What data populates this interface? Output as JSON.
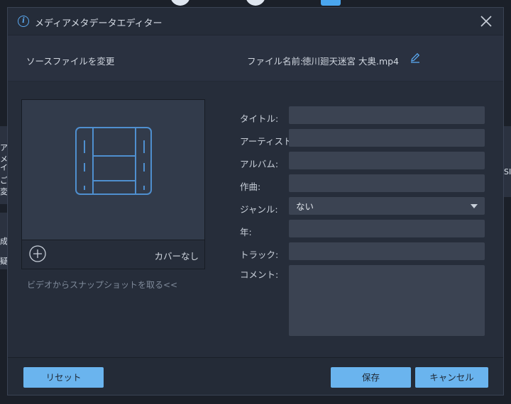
{
  "dialog": {
    "title": "メディアメタデータエディター",
    "source_change": "ソースファイルを変更",
    "filename_label": "ファイル名前:",
    "filename_value": "徳川廻天迷宮 大奥.mp4"
  },
  "cover": {
    "none_label": "カバーなし",
    "snapshot_link": "ビデオからスナップショットを取る<<"
  },
  "fields": {
    "title_label": "タイトル:",
    "title_value": "",
    "artist_label": "アーティスト:",
    "artist_value": "",
    "album_label": "アルバム:",
    "album_value": "",
    "composer_label": "作曲:",
    "composer_value": "",
    "genre_label": "ジャンル:",
    "genre_value": "ない",
    "year_label": "年:",
    "year_value": "",
    "track_label": "トラック:",
    "track_value": "",
    "comment_label": "コメント:",
    "comment_value": ""
  },
  "buttons": {
    "reset": "リセット",
    "save": "保存",
    "cancel": "キャンセル"
  },
  "background": {
    "fragments": [
      "アメ",
      "イ",
      "ご変",
      "成",
      "疑",
      "SII"
    ]
  },
  "colors": {
    "accent": "#6ab4ee",
    "dialog_bg": "#2a3140",
    "input_bg": "#3b4352"
  },
  "icons": [
    "info-icon",
    "close-icon",
    "edit-icon",
    "film-icon",
    "add-icon",
    "chevron-down-icon"
  ]
}
